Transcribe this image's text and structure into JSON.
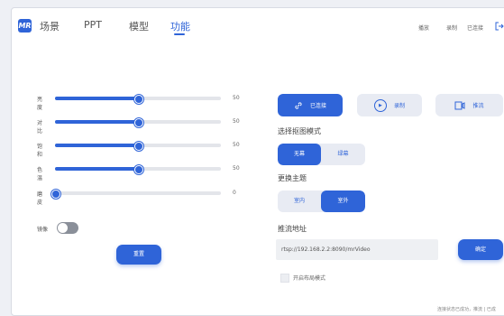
{
  "logo_text": "MR",
  "nav": {
    "tabs": [
      {
        "label": "场景"
      },
      {
        "label": "PPT"
      },
      {
        "label": "模型"
      },
      {
        "label": "功能"
      }
    ],
    "active_tab": "功能",
    "right_links": [
      {
        "label": "播放"
      },
      {
        "label": "录制"
      },
      {
        "label": "已连接"
      }
    ]
  },
  "sliders": [
    {
      "label": "亮度",
      "value": "50"
    },
    {
      "label": "对比",
      "value": "50"
    },
    {
      "label": "饱和",
      "value": "50"
    },
    {
      "label": "色温",
      "value": "50"
    },
    {
      "label": "磨皮",
      "value": "0"
    }
  ],
  "mirror": {
    "label": "镜像",
    "on": false
  },
  "reset_label": "重置",
  "actions": {
    "connect": "已连接",
    "record": "录制",
    "stream": "推流"
  },
  "matting": {
    "title": "选择抠图模式",
    "options": [
      "无幕",
      "绿幕"
    ],
    "selected": "无幕"
  },
  "theme": {
    "title": "更换主题",
    "options": [
      "室内",
      "室外"
    ],
    "selected": "室外"
  },
  "stream_addr": {
    "title": "推流地址",
    "value": "rtsp://192.168.2.2:8090/mrVideo",
    "confirm_label": "确定"
  },
  "layout_mode": {
    "label": "开启布局模式",
    "checked": false
  },
  "footer_text": "连接状态已成功，推流 | 已成"
}
